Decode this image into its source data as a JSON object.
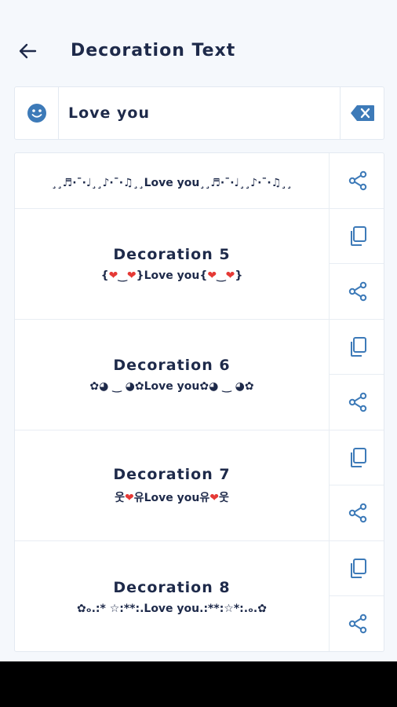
{
  "header": {
    "title": "Decoration Text"
  },
  "input": {
    "value": "Love you"
  },
  "items": [
    {
      "name": "",
      "deco": "¸¸♬·¯·♩¸¸♪·¯·♫¸¸Love you¸¸♬·¯·♩¸¸♪·¯·♫¸¸"
    },
    {
      "name": "Decoration 5",
      "deco": "{❤️‿❤️}Love you{❤️‿❤️}"
    },
    {
      "name": "Decoration 6",
      "deco": "✿◕ ‿ ◕✿Love you✿◕ ‿ ◕✿"
    },
    {
      "name": "Decoration 7",
      "deco": "웃❤️유Love you유❤️웃"
    },
    {
      "name": "Decoration 8",
      "deco": "✿ₒ.:* ☆:**:.Love you.:**:☆*:.ₒ.✿"
    }
  ],
  "icons": {
    "back": "arrow-left-icon",
    "emoji": "smiley-icon",
    "clear": "backspace-icon",
    "copy": "copy-icon",
    "share": "share-icon"
  },
  "colors": {
    "accent": "#3d7ab8",
    "text": "#1e2a4a",
    "heart": "#e53935"
  }
}
